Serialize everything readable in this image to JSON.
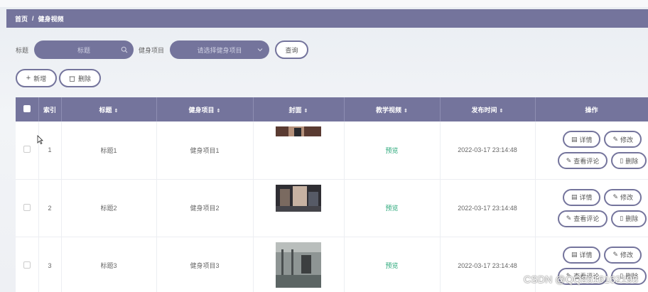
{
  "breadcrumb": {
    "home": "首页",
    "separator": "/",
    "current": "健身视频"
  },
  "search": {
    "title_label": "标题",
    "title_placeholder": "标题",
    "project_label": "健身项目",
    "project_placeholder": "请选择健身项目",
    "query_button": "查询"
  },
  "actions": {
    "add_button": "新增",
    "delete_button": "删除"
  },
  "table": {
    "headers": {
      "index": "索引",
      "title": "标题",
      "project": "健身项目",
      "cover": "封面",
      "video": "教学视频",
      "publish_time": "发布时间",
      "ops": "操作"
    },
    "rows": [
      {
        "index": "1",
        "title": "标题1",
        "project": "健身项目1",
        "video": "预览",
        "publish_time": "2022-03-17 23:14:48"
      },
      {
        "index": "2",
        "title": "标题2",
        "project": "健身项目2",
        "video": "预览",
        "publish_time": "2022-03-17 23:14:48"
      },
      {
        "index": "3",
        "title": "标题3",
        "project": "健身项目3",
        "video": "预览",
        "publish_time": "2022-03-17 23:14:48"
      }
    ],
    "row_buttons": {
      "detail": "详情",
      "edit": "修改",
      "comments": "查看评论",
      "delete": "删除"
    }
  },
  "watermark": "CSDN @QQ2616162193",
  "colors": {
    "accent": "#74749c",
    "preview_link": "#2aa87a"
  }
}
